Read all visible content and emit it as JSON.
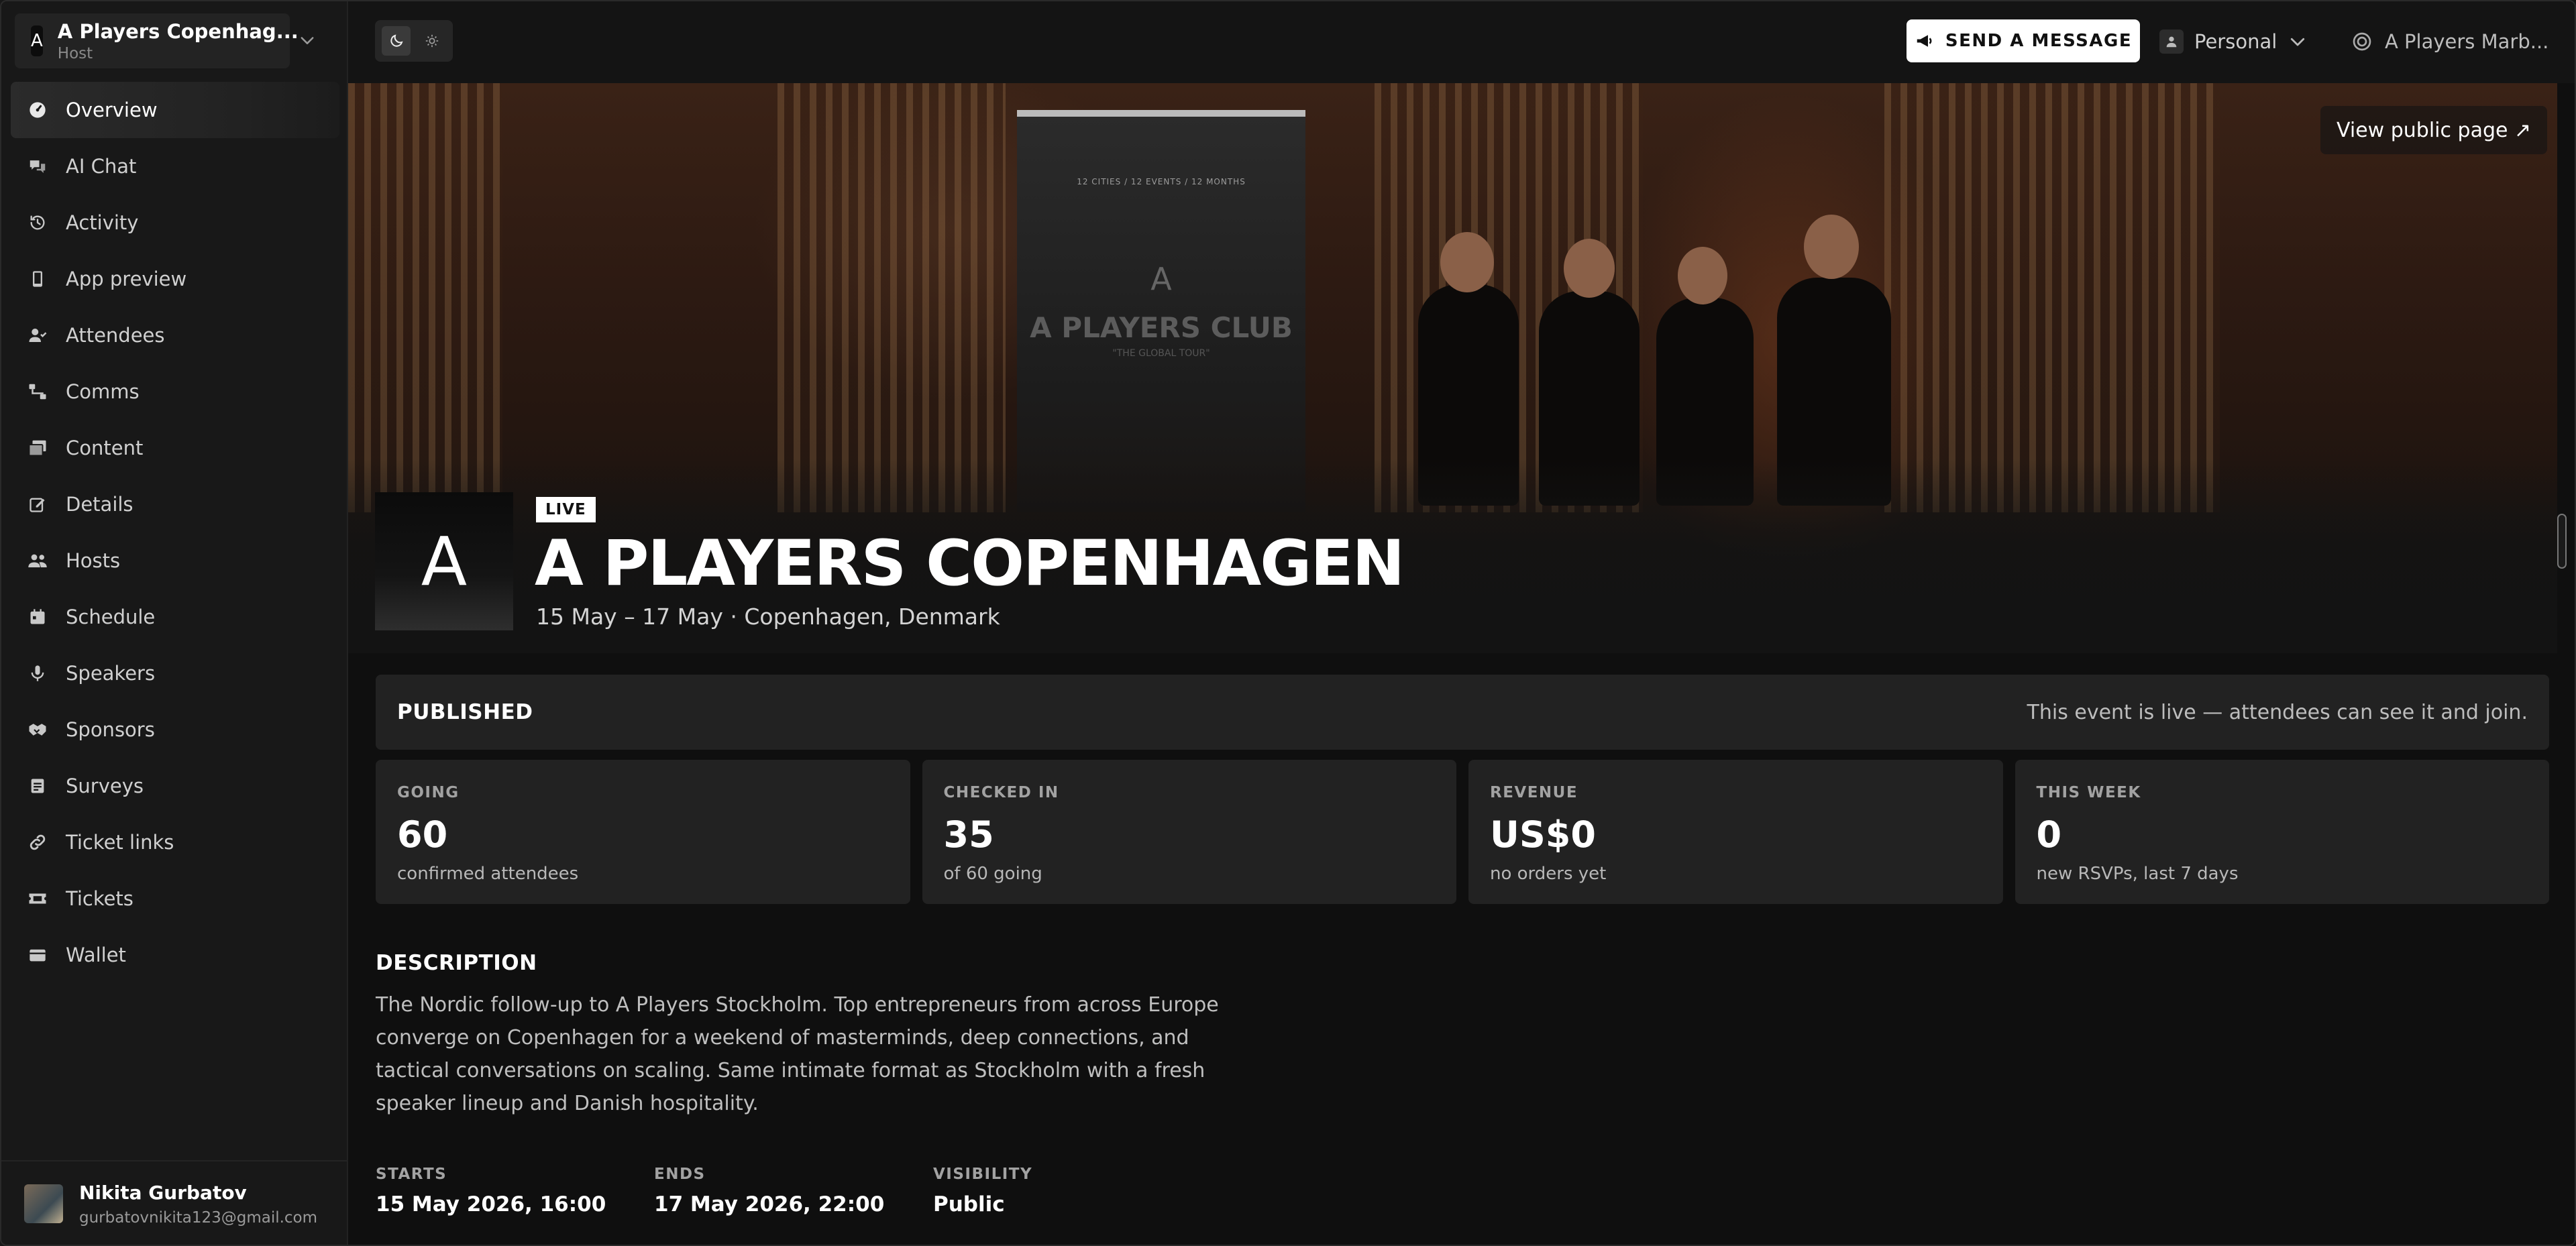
{
  "workspace": {
    "logo_letter": "A",
    "name": "A Players Copenhag...",
    "role": "Host"
  },
  "nav": {
    "items": [
      {
        "label": "Overview",
        "icon": "dashboard-icon",
        "active": true
      },
      {
        "label": "AI Chat",
        "icon": "chat-icon"
      },
      {
        "label": "Activity",
        "icon": "history-icon"
      },
      {
        "label": "App preview",
        "icon": "phone-icon"
      },
      {
        "label": "Attendees",
        "icon": "user-check-icon"
      },
      {
        "label": "Comms",
        "icon": "share-nodes-icon"
      },
      {
        "label": "Content",
        "icon": "images-icon"
      },
      {
        "label": "Details",
        "icon": "edit-icon"
      },
      {
        "label": "Hosts",
        "icon": "users-icon"
      },
      {
        "label": "Schedule",
        "icon": "calendar-icon"
      },
      {
        "label": "Speakers",
        "icon": "microphone-icon"
      },
      {
        "label": "Sponsors",
        "icon": "handshake-icon"
      },
      {
        "label": "Surveys",
        "icon": "clipboard-icon"
      },
      {
        "label": "Ticket links",
        "icon": "link-icon"
      },
      {
        "label": "Tickets",
        "icon": "ticket-icon"
      },
      {
        "label": "Wallet",
        "icon": "wallet-icon"
      }
    ]
  },
  "user": {
    "name": "Nikita Gurbatov",
    "email": "gurbatovnikita123@gmail.com"
  },
  "topbar": {
    "send_label": "SEND A MESSAGE",
    "personal_label": "Personal",
    "account_label": "A Players Marb..."
  },
  "hero": {
    "view_public_label": "View public page ↗",
    "logo_letter": "A",
    "status_badge": "LIVE",
    "title": "A PLAYERS COPENHAGEN",
    "subtitle": "15 May – 17 May · Copenhagen, Denmark",
    "banner_line1": "12 CITIES / 12 EVENTS / 12 MONTHS",
    "banner_line2": "A PLAYERS CLUB",
    "banner_line3": "\"THE GLOBAL TOUR\""
  },
  "status": {
    "label": "PUBLISHED",
    "note": "This event is live — attendees can see it and join."
  },
  "stats": [
    {
      "label": "GOING",
      "value": "60",
      "sub": "confirmed attendees"
    },
    {
      "label": "CHECKED IN",
      "value": "35",
      "sub": "of 60 going"
    },
    {
      "label": "REVENUE",
      "value": "US$0",
      "sub": "no orders yet"
    },
    {
      "label": "THIS WEEK",
      "value": "0",
      "sub": "new RSVPs, last 7 days"
    }
  ],
  "description": {
    "heading": "DESCRIPTION",
    "text": "The Nordic follow-up to A Players Stockholm. Top entrepreneurs from across Europe converge on Copenhagen for a weekend of masterminds, deep connections, and tactical conversations on scaling. Same intimate format as Stockholm with a fresh speaker lineup and Danish hospitality."
  },
  "meta": {
    "starts_label": "STARTS",
    "starts_value": "15 May 2026, 16:00",
    "ends_label": "ENDS",
    "ends_value": "17 May 2026, 22:00",
    "visibility_label": "VISIBILITY",
    "visibility_value": "Public"
  }
}
